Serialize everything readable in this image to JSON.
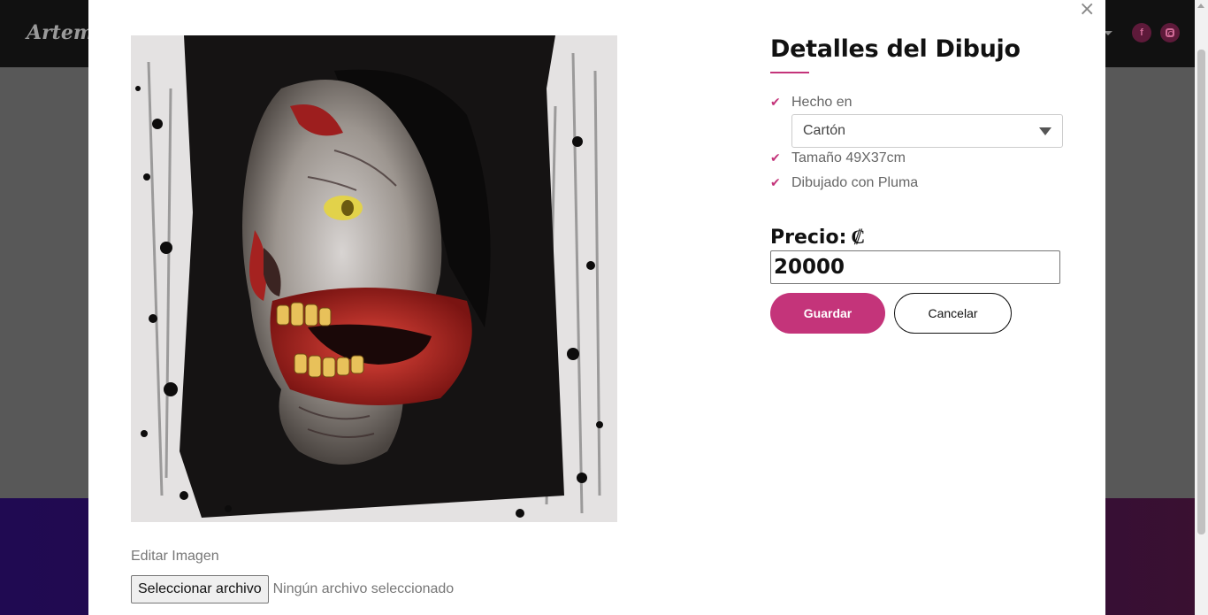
{
  "background": {
    "logo_text": "Artemc",
    "social_icons": [
      "facebook-icon",
      "instagram-icon"
    ],
    "facebook_glyph": "f"
  },
  "modal": {
    "close_glyph": "×",
    "artwork_description_icon": "zombie-drawing-image",
    "edit_image_label": "Editar Imagen",
    "file_button_label": "Seleccionar archivo",
    "file_status": "Ningún archivo seleccionado"
  },
  "details": {
    "title": "Detalles del Dibujo",
    "made_in_label": "Hecho en",
    "material_selected": "Cartón",
    "size_text": "Tamaño 49X37cm",
    "technique_text": "Dibujado con Pluma",
    "check_glyph": "✔"
  },
  "price": {
    "label": "Precio:",
    "currency_symbol": "₡",
    "value": "20000"
  },
  "buttons": {
    "save_label": "Guardar",
    "cancel_label": "Cancelar"
  },
  "colors": {
    "accent": "#c4347a",
    "footer_purple": "#200a52",
    "nav_black": "#111111"
  }
}
